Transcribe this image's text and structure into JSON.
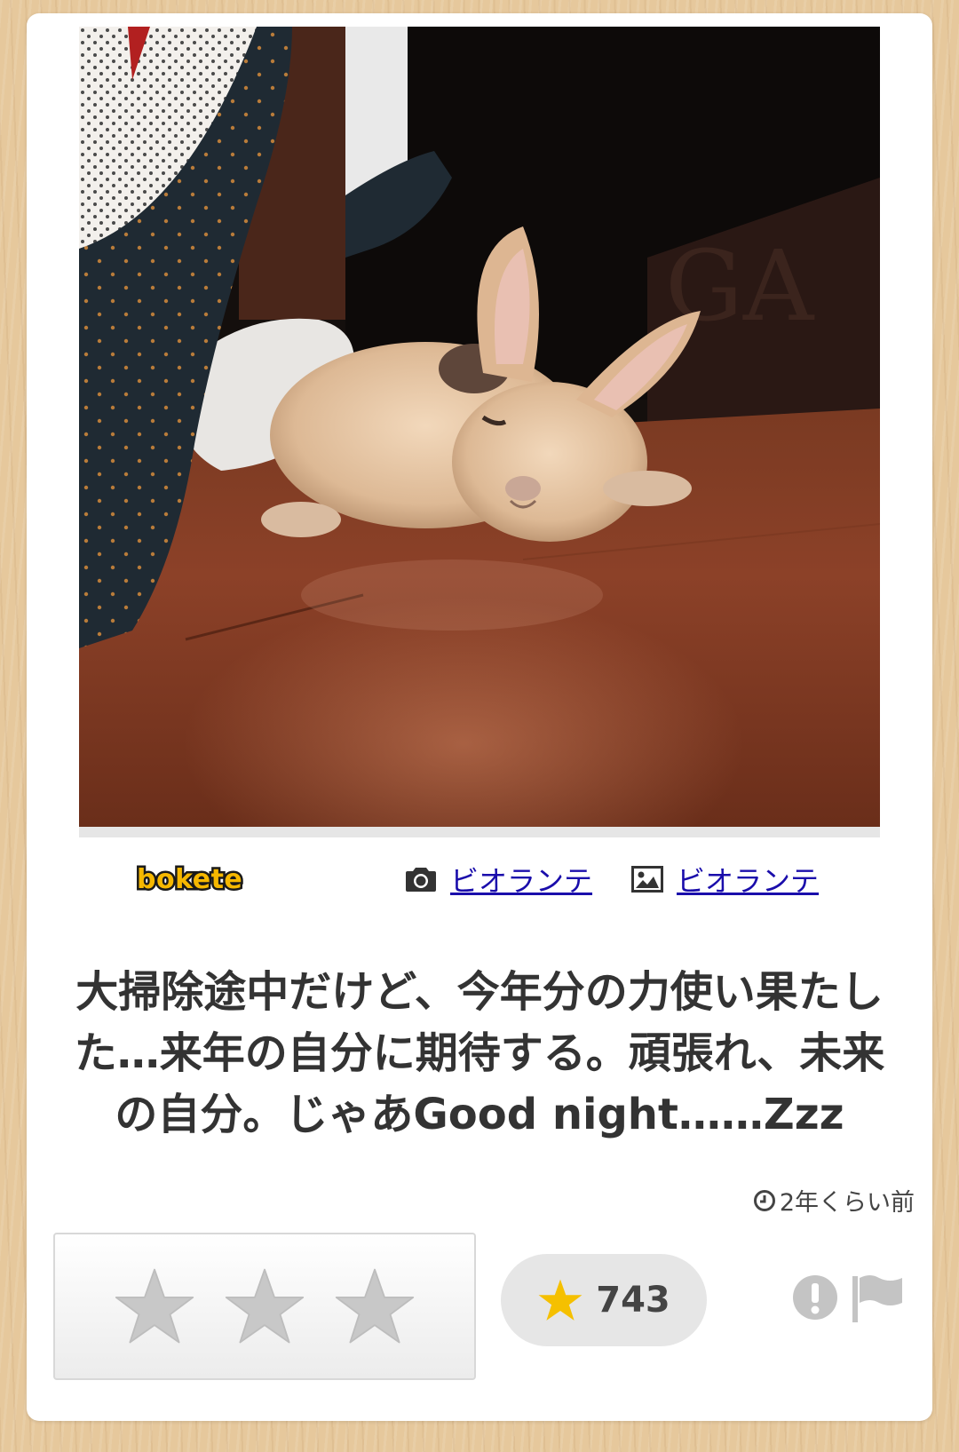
{
  "post": {
    "photo": {
      "description": "rabbit lying flat on wooden floor",
      "icon": "rabbit-photo"
    },
    "brand": {
      "logo_text": "bokete",
      "logo_color": "#f6b800"
    },
    "credits": {
      "photo_author": "ビオランテ",
      "image_author": "ビオランテ",
      "link_color": "#1a0dab"
    },
    "caption": "大掃除途中だけど、今年分の力使い果たした…来年の自分に期待する。頑張れ、未来の自分。じゃあGood night……Zzz",
    "posted_ago": "2年くらい前",
    "rating": {
      "stars": 3,
      "filled": 0,
      "star_color": "#c8c8c8"
    },
    "score": {
      "count": "743",
      "star_color": "#f5c000"
    },
    "actions": {
      "report_icon": "exclamation-circle-icon",
      "flag_icon": "flag-icon"
    }
  }
}
